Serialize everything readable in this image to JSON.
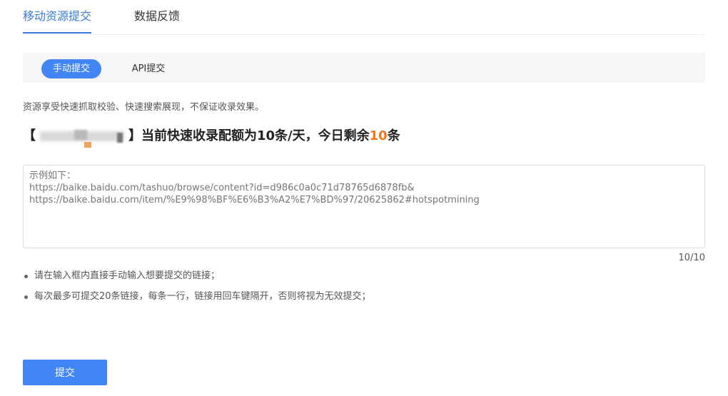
{
  "tabs": {
    "active": "移动资源提交",
    "second": "数据反馈"
  },
  "subtabs": {
    "manual": "手动提交",
    "api": "API提交"
  },
  "description": "资源享受快速抓取校验、快速搜索展现，不保证收录效果。",
  "headline": {
    "open_bracket": "【",
    "close_bracket": "】",
    "text": "当前快速收录配额为10条/天，今日剩余",
    "remaining": "10",
    "unit": "条"
  },
  "textarea": {
    "placeholder": "示例如下：\nhttps://baike.baidu.com/tashuo/browse/content?id=d986c0a0c71d78765d6878fb&\nhttps://baike.baidu.com/item/%E9%98%BF%E6%B3%A2%E7%BD%97/20625862#hotspotmining"
  },
  "counter": "10/10",
  "rules": [
    "请在输入框内直接手动输入想要提交的链接；",
    "每次最多可提交20条链接，每条一行，链接用回车键隔开，否则将视为无效提交；"
  ],
  "submit_label": "提交",
  "colors": {
    "accent": "#4285f4",
    "tab_active": "#3a7bd5",
    "highlight": "#f5761a"
  }
}
